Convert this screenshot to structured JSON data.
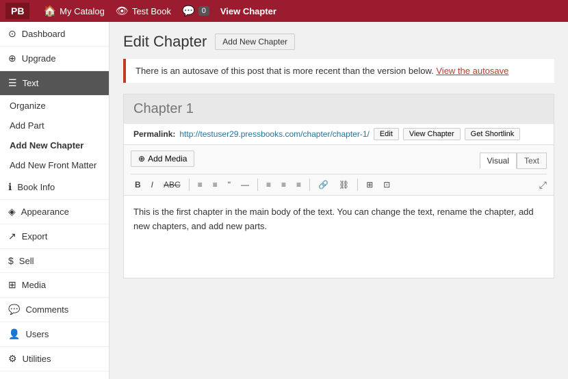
{
  "topbar": {
    "logo": "PB",
    "catalog_label": "My Catalog",
    "book_label": "Test Book",
    "comments_count": "0",
    "view_chapter_label": "View Chapter"
  },
  "sidebar": {
    "items": [
      {
        "id": "dashboard",
        "icon": "⊙",
        "label": "Dashboard"
      },
      {
        "id": "upgrade",
        "icon": "⊕",
        "label": "Upgrade"
      },
      {
        "id": "text",
        "icon": "☰",
        "label": "Text",
        "active": true
      }
    ],
    "sub_items": [
      {
        "id": "organize",
        "label": "Organize",
        "bold": false
      },
      {
        "id": "add-part",
        "label": "Add Part",
        "bold": false
      },
      {
        "id": "add-new-chapter",
        "label": "Add New Chapter",
        "bold": true
      },
      {
        "id": "add-new-front-matter",
        "label": "Add New Front Matter",
        "bold": false
      }
    ],
    "lower_items": [
      {
        "id": "book-info",
        "icon": "ℹ",
        "label": "Book Info"
      },
      {
        "id": "appearance",
        "icon": "◈",
        "label": "Appearance"
      },
      {
        "id": "export",
        "icon": "↗",
        "label": "Export"
      },
      {
        "id": "sell",
        "icon": "$",
        "label": "Sell"
      },
      {
        "id": "media",
        "icon": "⊞",
        "label": "Media"
      },
      {
        "id": "comments",
        "icon": "💬",
        "label": "Comments"
      },
      {
        "id": "users",
        "icon": "👤",
        "label": "Users"
      },
      {
        "id": "utilities",
        "icon": "⚙",
        "label": "Utilities"
      }
    ]
  },
  "main": {
    "page_title": "Edit Chapter",
    "add_chapter_btn": "Add New Chapter",
    "autosave_notice": "There is an autosave of this post that is more recent than the version below.",
    "autosave_link": "View the autosave",
    "chapter_title_placeholder": "Chapter 1",
    "permalink_label": "Permalink:",
    "permalink_url": "http://testuser29.pressbooks.com/chapter/chapter-1/",
    "edit_btn": "Edit",
    "view_chapter_btn": "View Chapter",
    "get_shortlink_btn": "Get Shortlink",
    "add_media_btn": "Add Media",
    "visual_tab": "Visual",
    "text_tab": "Text",
    "toolbar": {
      "bold": "B",
      "italic": "I",
      "strikethrough": "ABC",
      "ul": "≡",
      "ol": "≡",
      "blockquote": "❝",
      "hr": "—",
      "align_left": "≡",
      "align_center": "≡",
      "align_right": "≡",
      "link": "🔗",
      "unlink": "⛓",
      "table": "⊞",
      "table2": "⊡",
      "fullscreen": "⤢"
    },
    "editor_content": "This is the first chapter in the main body of the text. You can change the text, rename the chapter, add new chapters, and add new parts."
  }
}
